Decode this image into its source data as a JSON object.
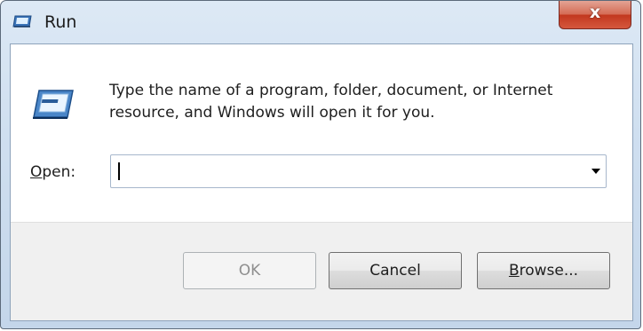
{
  "window": {
    "title": "Run",
    "close_glyph": "x",
    "title_icon": "run-icon"
  },
  "dialog": {
    "description": "Type the name of a program, folder, document, or Internet resource, and Windows will open it for you.",
    "icon": "run-icon"
  },
  "open_field": {
    "label_accel": "O",
    "label_rest": "pen:",
    "value": "",
    "dropdown_icon": "chevron-down-icon"
  },
  "buttons": {
    "ok": "OK",
    "cancel": "Cancel",
    "browse_accel": "B",
    "browse_rest": "rowse..."
  },
  "colors": {
    "close_button": "#c2381f",
    "frame": "#cfdff0"
  }
}
